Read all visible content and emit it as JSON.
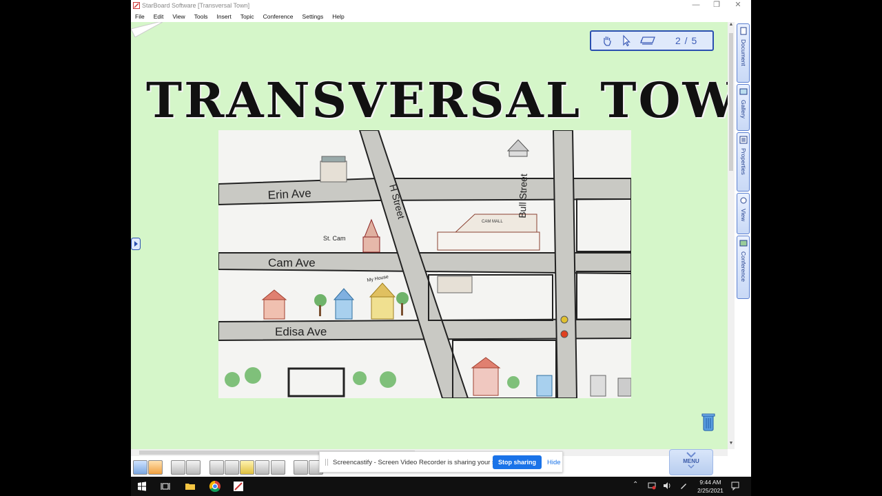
{
  "window": {
    "title": "StarBoard Software [Transversal Town]"
  },
  "menu": [
    "File",
    "Edit",
    "View",
    "Tools",
    "Insert",
    "Topic",
    "Conference",
    "Settings",
    "Help"
  ],
  "nav": {
    "page_indicator": "2 / 5"
  },
  "slide": {
    "headline": "TRANSVERSAL TOWN",
    "map_labels": {
      "erin_ave": "Erin   Ave",
      "cam_ave": "Cam   Ave",
      "edisa_ave": "Edisa   Ave",
      "h_street": "H Street",
      "bull_street": "Bull Street",
      "st_cam": "St. Cam",
      "mall": "CAM MALL",
      "my_house": "My House"
    }
  },
  "side_tabs": [
    "Document",
    "Gallery",
    "Properties",
    "View",
    "Conference"
  ],
  "menu_button": {
    "label": "MENU"
  },
  "screen_share": {
    "message": "Screencastify - Screen Video Recorder is sharing your screen.",
    "stop_label": "Stop sharing",
    "hide_label": "Hide"
  },
  "taskbar": {
    "time": "9:44 AM",
    "date": "2/25/2021"
  },
  "colors": {
    "canvas_bg": "#d5f6c9",
    "accent": "#2a4fb0",
    "share_button": "#1a73e8"
  }
}
